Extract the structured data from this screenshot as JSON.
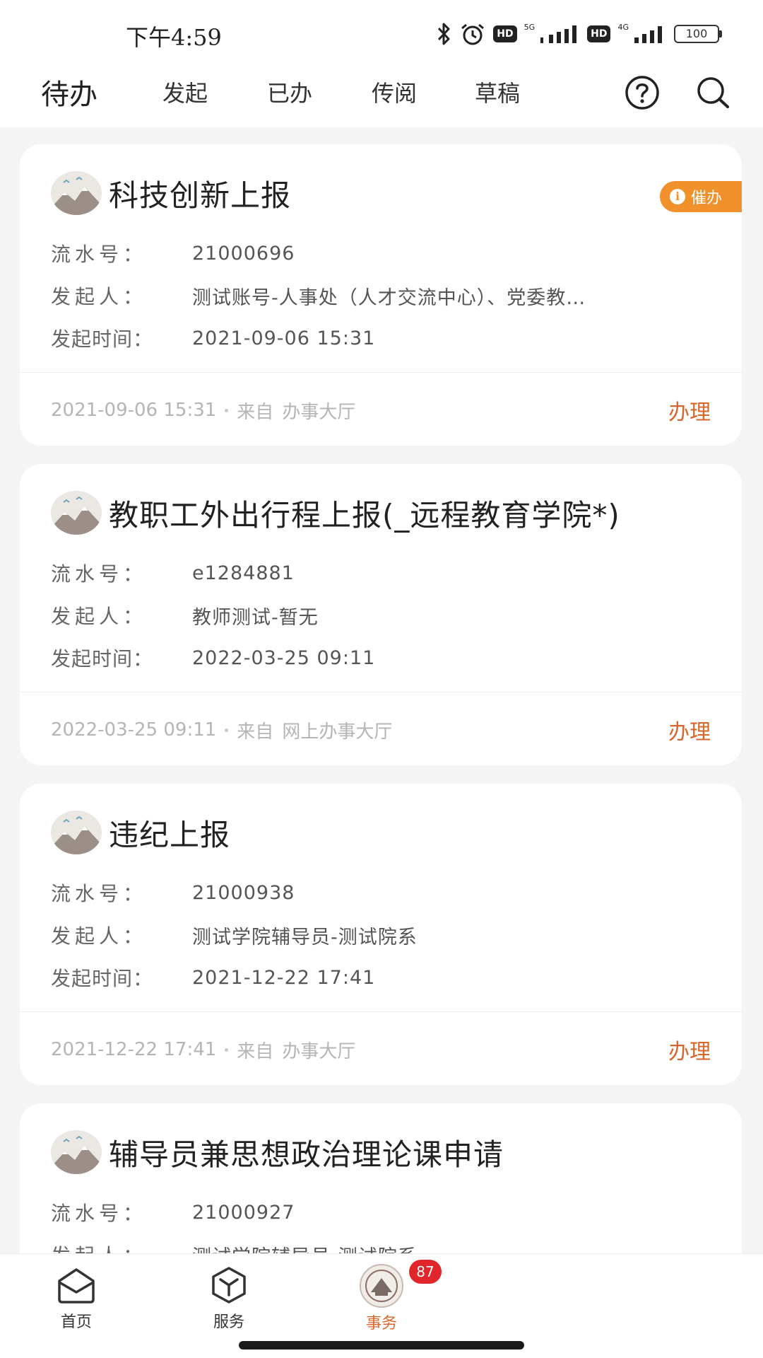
{
  "status_bar": {
    "time": "下午4:59",
    "net1": "5G",
    "net2": "4G",
    "hd": "HD",
    "battery": "100"
  },
  "tabs": {
    "active": "待办",
    "items": [
      "发起",
      "已办",
      "传阅",
      "草稿"
    ]
  },
  "labels": {
    "serial": "流水号：",
    "initiator": "发起人：",
    "time": "发起时间：",
    "from": "来自",
    "handle": "办理",
    "urge": "催办"
  },
  "cards": [
    {
      "title": "科技创新上报",
      "serial": "21000696",
      "initiator": "测试账号-人事处（人才交流中心）、党委教…",
      "time": "2021-09-06 15:31",
      "foot_time": "2021-09-06 15:31",
      "source": "办事大厅"
    },
    {
      "title": "教职工外出行程上报(_远程教育学院*)",
      "serial": "e1284881",
      "initiator": "教师测试-暂无",
      "time": "2022-03-25 09:11",
      "foot_time": "2022-03-25 09:11",
      "source": "网上办事大厅"
    },
    {
      "title": "违纪上报",
      "serial": "21000938",
      "initiator": "测试学院辅导员-测试院系",
      "time": "2021-12-22 17:41",
      "foot_time": "2021-12-22 17:41",
      "source": "办事大厅"
    },
    {
      "title": "辅导员兼思想政治理论课申请",
      "serial": "21000927",
      "initiator": "测试学院辅导员-测试院系"
    }
  ],
  "bottom_nav": {
    "home": "首页",
    "service": "服务",
    "affairs": "事务",
    "affairs_badge": "87"
  },
  "colors": {
    "accent": "#d9662b",
    "urge": "#f0912b",
    "badge": "#e0262a"
  }
}
